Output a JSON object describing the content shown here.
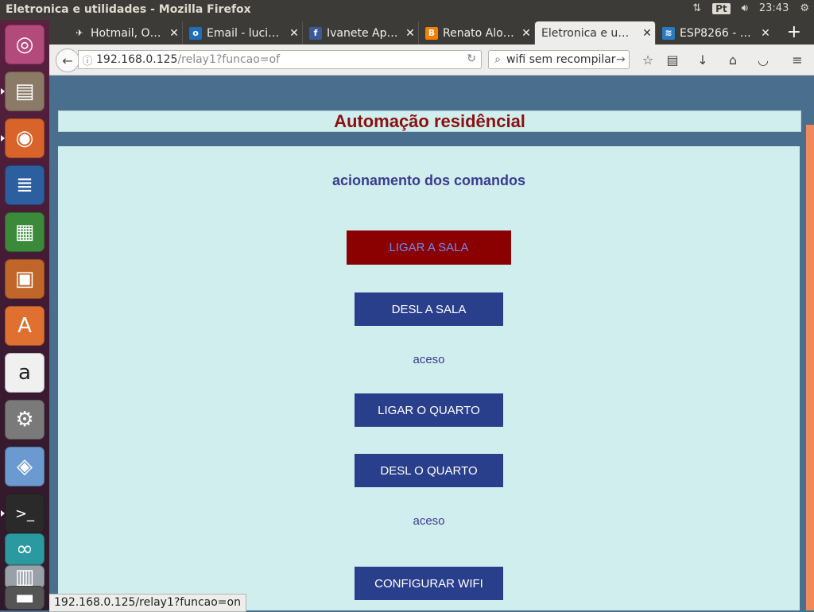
{
  "top_panel": {
    "window_title": "Eletronica e utilidades - Mozilla Firefox",
    "keyboard_layout": "Pt",
    "time": "23:43"
  },
  "tabs": [
    {
      "label": "Hotmail, O…",
      "favicon": "hotmail-icon",
      "active": false
    },
    {
      "label": "Email - luci…",
      "favicon": "outlook-icon",
      "active": false
    },
    {
      "label": "Ivanete Ap…",
      "favicon": "facebook-icon",
      "active": false
    },
    {
      "label": "Renato Alo…",
      "favicon": "blogger-icon",
      "active": false
    },
    {
      "label": "Eletronica e u…",
      "favicon": "",
      "active": true
    },
    {
      "label": "ESP8266 - …",
      "favicon": "esp-icon",
      "active": false
    }
  ],
  "navbar": {
    "url_host": "192.168.0.125",
    "url_path": "/relay1?funcao=of",
    "search_value": "wifi sem recompilar"
  },
  "page": {
    "title": "Automação residêncial",
    "subtitle": "acionamento dos comandos",
    "buttons": {
      "ligar_sala": "LIGAR A SALA",
      "desl_sala": "DESL A SALA",
      "ligar_quarto": "LIGAR O QUARTO",
      "desl_quarto": "DESL O QUARTO",
      "config_wifi": "CONFIGURAR WIFI"
    },
    "status_sala": "aceso",
    "status_quarto": "aceso"
  },
  "link_status": "192.168.0.125/relay1?funcao=on",
  "colors": {
    "page_bg": "#4a6e8e",
    "box_bg": "#d0eeee",
    "title": "#8b1010",
    "button": "#2a3f8c",
    "button_active": "#8b0000"
  }
}
